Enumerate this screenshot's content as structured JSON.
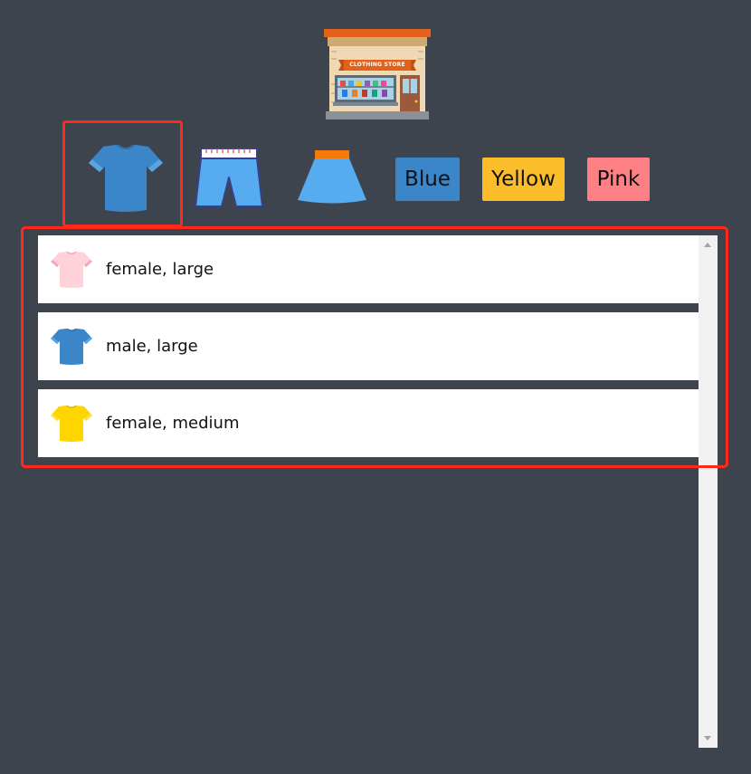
{
  "store": {
    "sign_text": "CLOTHING STORE",
    "icon": "clothing-store-icon"
  },
  "filters": {
    "categories": [
      {
        "name": "tshirt",
        "icon": "tshirt-icon",
        "selected": true
      },
      {
        "name": "shorts",
        "icon": "shorts-icon",
        "selected": false
      },
      {
        "name": "skirt",
        "icon": "skirt-icon",
        "selected": false
      }
    ],
    "colors": [
      {
        "label": "Blue",
        "color": "#3a86c8"
      },
      {
        "label": "Yellow",
        "color": "#fbbd2a"
      },
      {
        "label": "Pink",
        "color": "#fe8085"
      }
    ]
  },
  "items": [
    {
      "label": "female, large",
      "icon": "tshirt-icon",
      "color": "#ffd1d9"
    },
    {
      "label": "male, large",
      "icon": "tshirt-icon",
      "color": "#3a86c8"
    },
    {
      "label": "female, medium",
      "icon": "tshirt-icon",
      "color": "#ffd500"
    }
  ],
  "colors": {
    "background": "#3e444d",
    "highlight": "#ff2a1a"
  }
}
